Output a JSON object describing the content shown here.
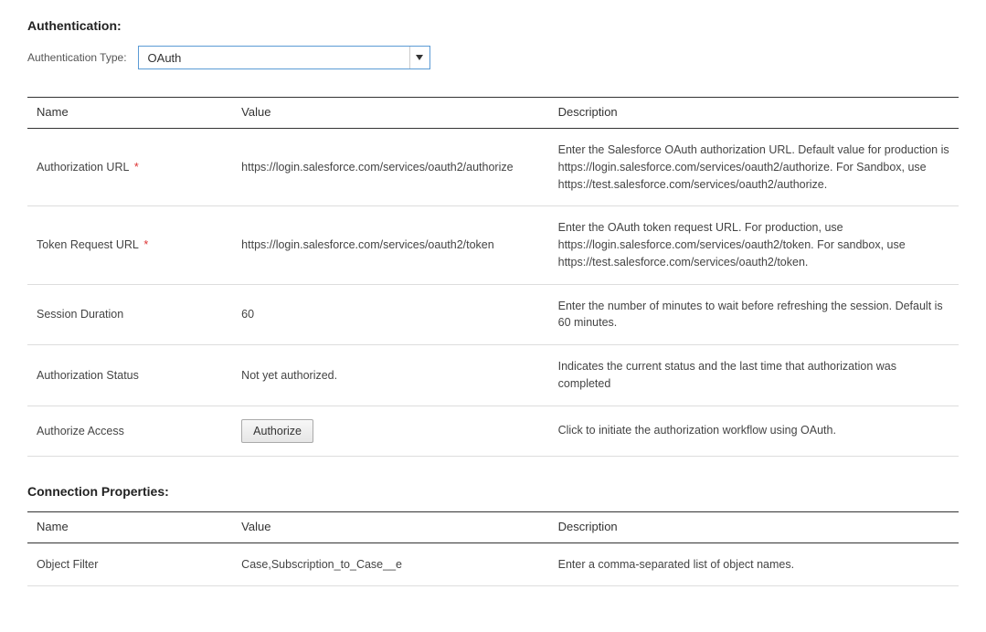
{
  "authentication": {
    "heading": "Authentication:",
    "type_label": "Authentication Type:",
    "type_value": "OAuth",
    "columns": {
      "name": "Name",
      "value": "Value",
      "description": "Description"
    },
    "rows": [
      {
        "name": "Authorization URL",
        "required": true,
        "value": "https://login.salesforce.com/services/oauth2/authorize",
        "description": "Enter the Salesforce OAuth authorization URL. Default value for production is https://login.salesforce.com/services/oauth2/authorize. For Sandbox, use https://test.salesforce.com/services/oauth2/authorize."
      },
      {
        "name": "Token Request URL",
        "required": true,
        "value": "https://login.salesforce.com/services/oauth2/token",
        "description": "Enter the OAuth token request URL. For production, use https://login.salesforce.com/services/oauth2/token. For sandbox, use https://test.salesforce.com/services/oauth2/token."
      },
      {
        "name": "Session Duration",
        "required": false,
        "value": "60",
        "description": "Enter the number of minutes to wait before refreshing the session.  Default is 60 minutes."
      },
      {
        "name": "Authorization Status",
        "required": false,
        "value": "Not yet authorized.",
        "description": "Indicates the current status and the last time that authorization was completed"
      },
      {
        "name": "Authorize Access",
        "required": false,
        "button": "Authorize",
        "description": "Click to initiate the authorization workflow using OAuth."
      }
    ]
  },
  "connection_properties": {
    "heading": "Connection Properties:",
    "columns": {
      "name": "Name",
      "value": "Value",
      "description": "Description"
    },
    "rows": [
      {
        "name": "Object Filter",
        "value": "Case,Subscription_to_Case__e",
        "description": "Enter a comma-separated list of object names."
      }
    ]
  }
}
